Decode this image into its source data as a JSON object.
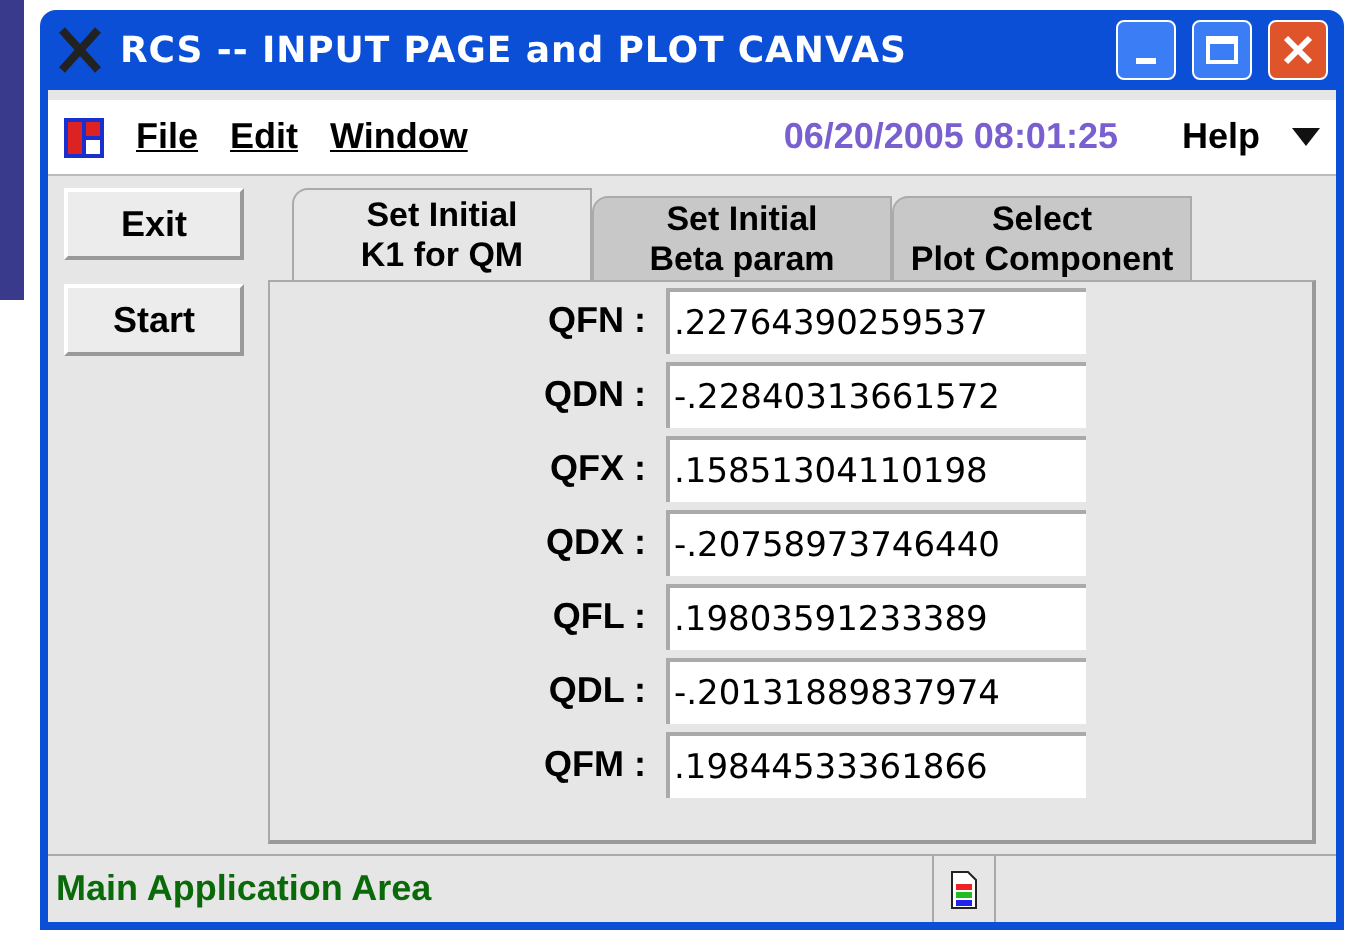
{
  "window": {
    "title": "RCS -- INPUT PAGE and PLOT CANVAS"
  },
  "menu": {
    "items": [
      "File",
      "Edit",
      "Window"
    ],
    "datetime": "06/20/2005 08:01:25",
    "help": "Help"
  },
  "buttons": [
    "Exit",
    "Start"
  ],
  "tabs": [
    {
      "line1": "Set Initial",
      "line2": "K1 for QM",
      "selected": true
    },
    {
      "line1": "Set Initial",
      "line2": "Beta param",
      "selected": false
    },
    {
      "line1": "Select",
      "line2": "Plot Component",
      "selected": false
    }
  ],
  "fields": [
    {
      "label": "QFN :",
      "value": ".22764390259537"
    },
    {
      "label": "QDN :",
      "value": "-.22840313661572"
    },
    {
      "label": "QFX :",
      "value": ".15851304110198"
    },
    {
      "label": "QDX :",
      "value": "-.20758973746440"
    },
    {
      "label": "QFL :",
      "value": ".19803591233389"
    },
    {
      "label": "QDL :",
      "value": "-.20131889837974"
    },
    {
      "label": "QFM :",
      "value": ".19844533361866"
    }
  ],
  "status_bar": {
    "text": "Main Application Area"
  }
}
